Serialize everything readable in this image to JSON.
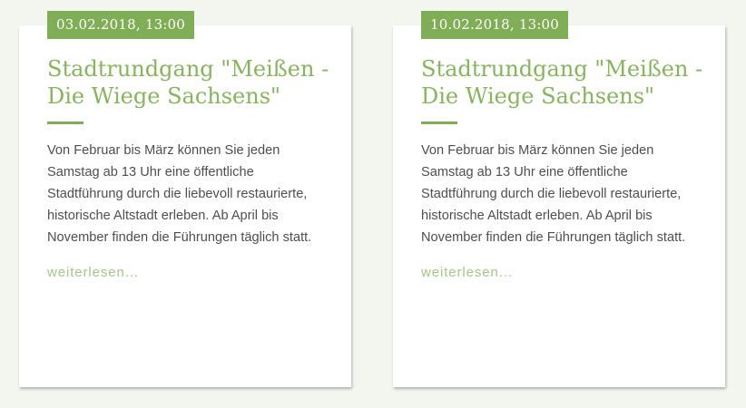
{
  "colors": {
    "accent": "#7fae56",
    "title": "#86b55c",
    "link": "#a3c784",
    "text": "#4e4e4e",
    "background": "#f2f6ef"
  },
  "events": [
    {
      "date": "03.02.2018, 13:00",
      "title": "Stadtrundgang \"Meißen - Die Wiege Sachsens\"",
      "text": "Von Februar bis März können Sie jeden Samstag ab 13 Uhr eine öffentliche Stadtführung durch die liebevoll restaurierte, historische Altstadt erleben. Ab April bis November finden die Führungen täglich statt.",
      "readmore": "weiterlesen..."
    },
    {
      "date": "10.02.2018, 13:00",
      "title": "Stadtrundgang \"Meißen - Die Wiege Sachsens\"",
      "text": "Von Februar bis März können Sie jeden Samstag ab 13 Uhr eine öffentliche Stadtführung durch die liebevoll restaurierte, historische Altstadt erleben. Ab April bis November finden die Führungen täglich statt.",
      "readmore": "weiterlesen..."
    }
  ]
}
